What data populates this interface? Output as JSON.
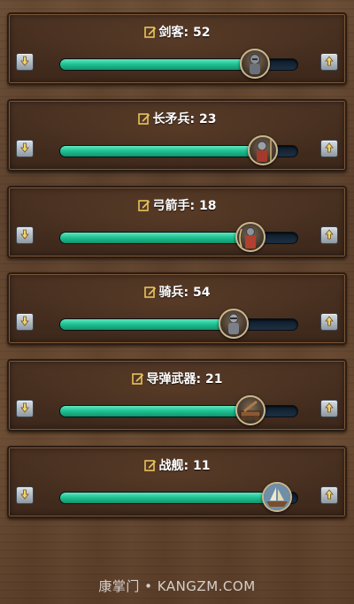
{
  "sliders": [
    {
      "name": "剑客",
      "value": "52",
      "fill_percent": 82,
      "portrait": "swordsman-icon"
    },
    {
      "name": "长矛兵",
      "value": "23",
      "fill_percent": 85,
      "portrait": "spearman-icon"
    },
    {
      "name": "弓箭手",
      "value": "18",
      "fill_percent": 80,
      "portrait": "archer-icon"
    },
    {
      "name": "骑兵",
      "value": "54",
      "fill_percent": 73,
      "portrait": "cavalry-icon"
    },
    {
      "name": "导弹武器",
      "value": "21",
      "fill_percent": 80,
      "portrait": "siege-weapon-icon"
    },
    {
      "name": "战舰",
      "value": "11",
      "fill_percent": 91,
      "portrait": "warship-icon"
    }
  ],
  "watermark": "康掌门 • KANGZM.COM",
  "colors": {
    "fill_start": "#62e6bf",
    "fill_end": "#12926c",
    "track": "#0e1b28",
    "panel": "#3d281b",
    "edit_icon": "#e8c35a"
  },
  "icons": {
    "decrease": "down-arrow-icon",
    "increase": "up-arrow-icon",
    "edit": "edit-pencil-icon"
  }
}
